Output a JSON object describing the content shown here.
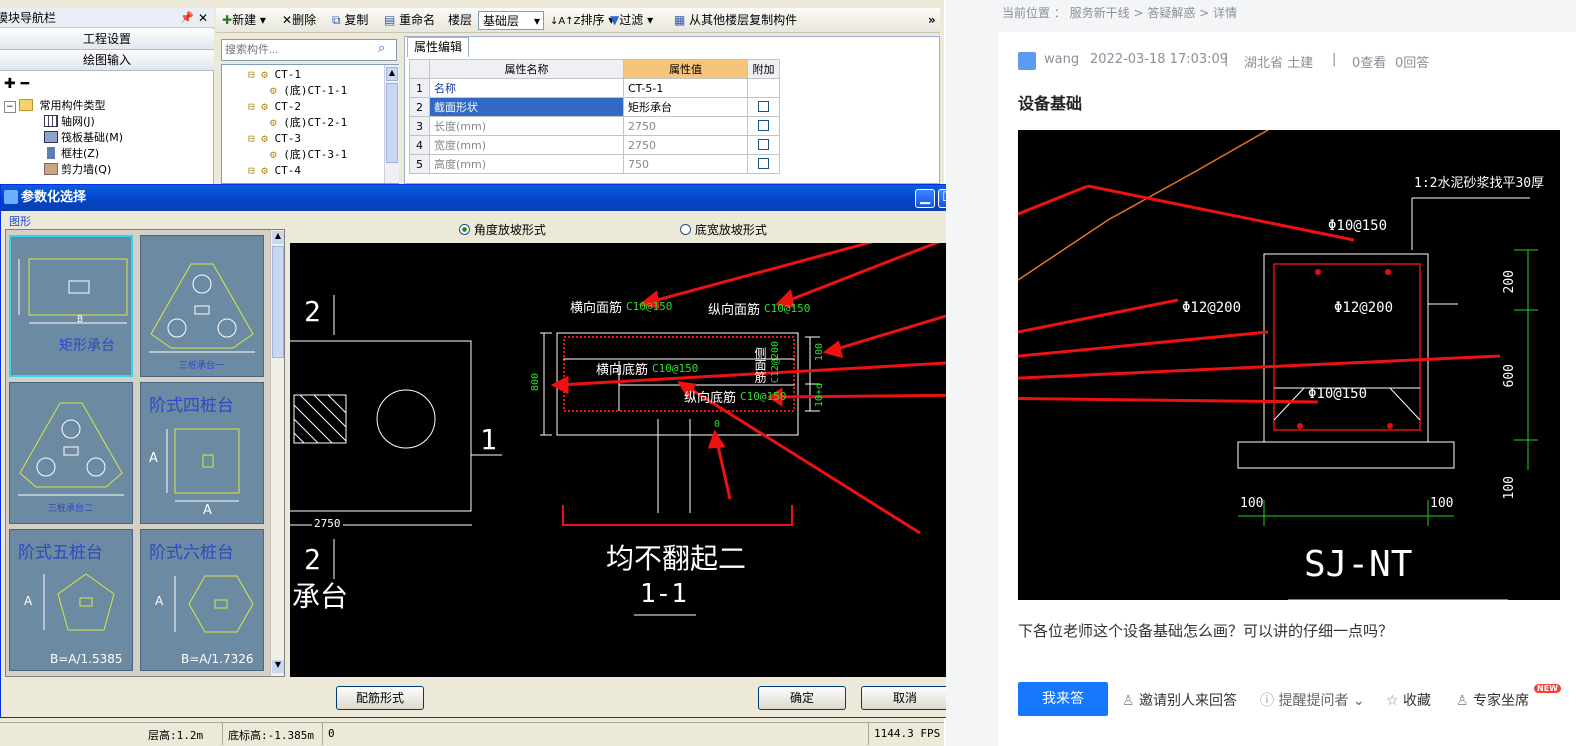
{
  "nav_panel": {
    "title": "模块导航栏",
    "buttons": [
      "工程设置",
      "绘图输入"
    ],
    "tree": {
      "root": "常用构件类型",
      "items": [
        "轴网(J)",
        "筏板基础(M)",
        "框柱(Z)",
        "剪力墙(Q)"
      ]
    }
  },
  "toolbar": {
    "new": "新建",
    "delete": "删除",
    "copy": "复制",
    "rename": "重命名",
    "floor_label": "楼层",
    "floor_value": "基础层",
    "sort": "排序",
    "filter": "过滤",
    "copy_from": "从其他楼层复制构件"
  },
  "search": {
    "placeholder": "搜索构件..."
  },
  "component_tree": [
    "CT-1",
    "(底)CT-1-1",
    "CT-2",
    "(底)CT-2-1",
    "CT-3",
    "(底)CT-3-1",
    "CT-4"
  ],
  "properties": {
    "tab": "属性编辑",
    "headers": [
      "属性名称",
      "属性值",
      "附加"
    ],
    "rows": [
      {
        "no": "1",
        "name": "名称",
        "value": "CT-5-1"
      },
      {
        "no": "2",
        "name": "截面形状",
        "value": "矩形承台"
      },
      {
        "no": "3",
        "name": "长度(mm)",
        "value": "2750"
      },
      {
        "no": "4",
        "name": "宽度(mm)",
        "value": "2750"
      },
      {
        "no": "5",
        "name": "高度(mm)",
        "value": "750"
      }
    ]
  },
  "dialog": {
    "title": "参数化选择",
    "group_label": "图形",
    "radio_angle": "角度放坡形式",
    "radio_width": "底宽放坡形式",
    "shapes": [
      "矩形承台",
      "三桩承台一",
      "三桩承台二",
      "阶式四桩台",
      "阶式五桩台",
      "阶式六桩台"
    ],
    "shape_extra": [
      "B",
      "A",
      "B=A/1.5385",
      "B=A/1.7326"
    ],
    "btn_rebar": "配筋形式",
    "btn_ok": "确定",
    "btn_cancel": "取消"
  },
  "cad_left": {
    "dim_2750": "2750",
    "section_no_top": "2",
    "section_no_bottom": "2",
    "section_no_right": "1",
    "caption": "承台"
  },
  "cad_section": {
    "top_transverse": "横向面筋",
    "top_transverse_val": "C10@150",
    "top_longitudinal": "纵向面筋",
    "top_longitudinal_val": "C10@150",
    "bot_transverse": "横向底筋",
    "bot_transverse_val": "C10@150",
    "bot_longitudinal": "纵向底筋",
    "bot_longitudinal_val": "C10@150",
    "side_bar": "侧面筋",
    "side_bar_val": "C12@200",
    "height_dim": "800",
    "top_cover": "100",
    "bot_cover": "10+d",
    "col_gap": "0",
    "note": "均不翻起二",
    "section": "1-1"
  },
  "status": {
    "floor_height": "层高:1.2m",
    "base_elev": "底标高:-1.385m",
    "zero": "0",
    "fps": "1144.3 FPS"
  },
  "web": {
    "breadcrumb": "当前位置 ： 服务新干线 > 答疑解惑 > 详情",
    "user": "wang",
    "datetime": "2022-03-18 17:03:09",
    "location": "湖北省  土建",
    "views": "0查看",
    "answers": "0回答",
    "title": "设备基础",
    "question": "下各位老师这个设备基础怎么画？可以讲的仔细一点吗？",
    "answer_btn": "我来答",
    "invite": "邀请别人来回答",
    "remind": "提醒提问者",
    "favorite": "收藏",
    "expert": "专家坐席",
    "new_badge": "NEW"
  },
  "drawing": {
    "cover_note": "1:2水泥砂浆找平30厚",
    "rebar_top": "Φ10@150",
    "rebar_side_left": "Φ12@200",
    "rebar_side_right": "Φ12@200",
    "rebar_bottom": "Φ10@150",
    "dim_200": "200",
    "dim_600": "600",
    "dim_100_right": "100",
    "dim_100_left": "100",
    "dim_100_right2": "100",
    "label": "SJ-NT"
  }
}
